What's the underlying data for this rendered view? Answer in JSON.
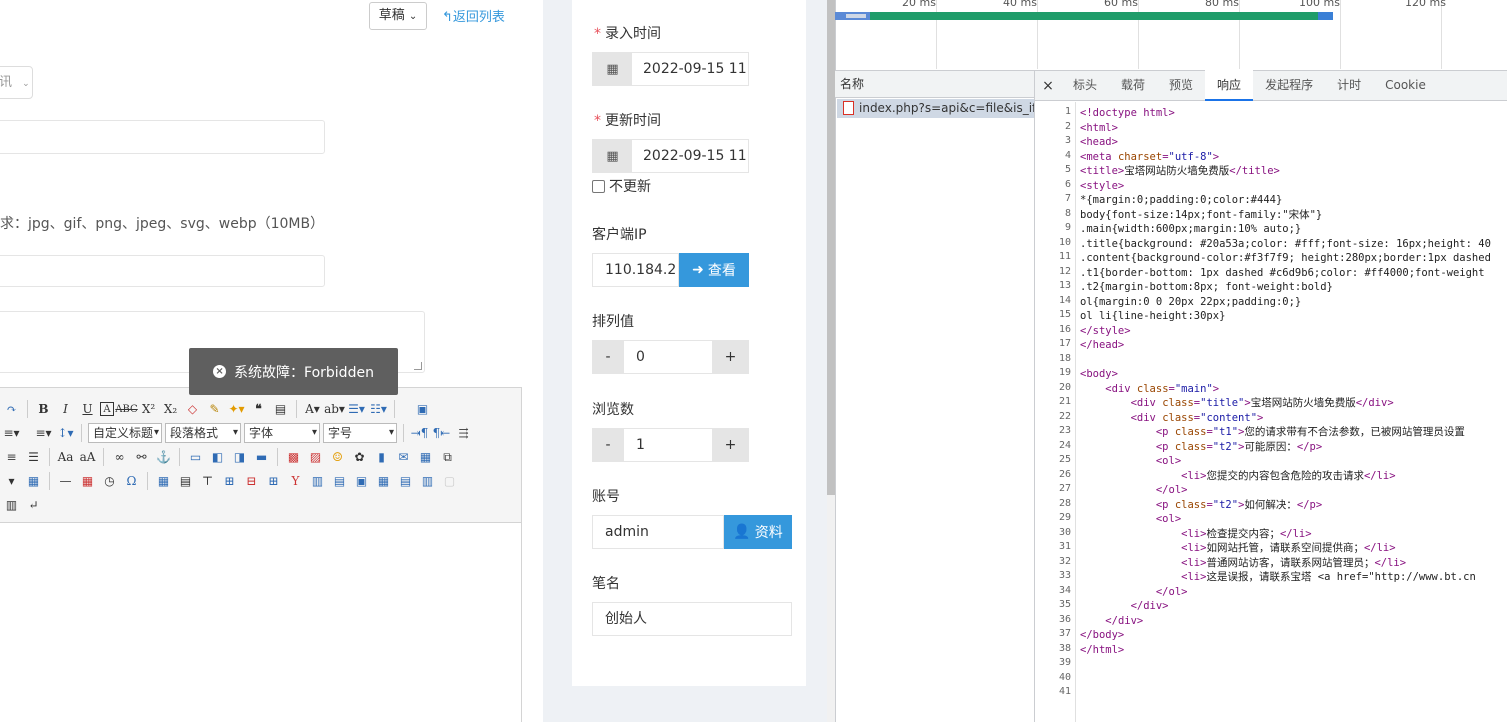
{
  "editor": {
    "draft_button": "草稿",
    "back_link": "返回列表",
    "fragment_select": "讯",
    "upload_hint": "求：jpg、gif、png、jpeg、svg、webp（10MB）",
    "toolbar": {
      "heading_dropdown": "自定义标题",
      "paragraph_dropdown": "段落格式",
      "font_dropdown": "字体",
      "size_dropdown": "字号"
    }
  },
  "toast": {
    "message": "系统故障：Forbidden"
  },
  "form": {
    "entry_time_label": "录入时间",
    "entry_time_value": "2022-09-15 11:",
    "update_time_label": "更新时间",
    "update_time_value": "2022-09-15 11:",
    "no_update_label": "不更新",
    "client_ip_label": "客户端IP",
    "client_ip_value": "110.184.2",
    "view_button": "查看",
    "sort_label": "排列值",
    "sort_value": "0",
    "views_label": "浏览数",
    "views_value": "1",
    "account_label": "账号",
    "account_value": "admin",
    "profile_button": "资料",
    "author_label": "笔名",
    "author_value": "创始人",
    "minus": "-",
    "plus": "+"
  },
  "devtools": {
    "timeline_labels": [
      "20 ms",
      "40 ms",
      "60 ms",
      "80 ms",
      "100 ms",
      "120 ms"
    ],
    "name_header": "名称",
    "request_name": "index.php?s=api&c=file&is_ifr...",
    "close_glyph": "×",
    "tabs": [
      "标头",
      "载荷",
      "预览",
      "响应",
      "发起程序",
      "计时",
      "Cookie"
    ],
    "active_tab": "响应",
    "line_numbers": [
      "1",
      "2",
      "3",
      "4",
      "5",
      "6",
      "7",
      "8",
      "9",
      "10",
      "11",
      "12",
      "13",
      "14",
      "15",
      "16",
      "17",
      "18",
      "19",
      "20",
      "21",
      "22",
      "23",
      "24",
      "25",
      "26",
      "27",
      "28",
      "29",
      "30",
      "31",
      "32",
      "33",
      "34",
      "35",
      "36",
      "37",
      "38",
      "39",
      "40",
      "41"
    ],
    "code_lines": [
      "<!doctype html>",
      "<html>",
      "<head>",
      "<meta charset=\"utf-8\">",
      "<title>宝塔网站防火墙免费版</title>",
      "<style>",
      "*{margin:0;padding:0;color:#444}",
      "body{font-size:14px;font-family:\"宋体\"}",
      ".main{width:600px;margin:10% auto;}",
      ".title{background: #20a53a;color: #fff;font-size: 16px;height: 40",
      ".content{background-color:#f3f7f9; height:280px;border:1px dashed",
      ".t1{border-bottom: 1px dashed #c6d9b6;color: #ff4000;font-weight",
      ".t2{margin-bottom:8px; font-weight:bold}",
      "ol{margin:0 0 20px 22px;padding:0;}",
      "ol li{line-height:30px}",
      "</style>",
      "</head>",
      "",
      "<body>",
      "    <div class=\"main\">",
      "        <div class=\"title\">宝塔网站防火墙免费版</div>",
      "        <div class=\"content\">",
      "            <p class=\"t1\">您的请求带有不合法参数，已被网站管理员设置",
      "            <p class=\"t2\">可能原因：</p>",
      "            <ol>",
      "                <li>您提交的内容包含危险的攻击请求</li>",
      "            </ol>",
      "            <p class=\"t2\">如何解决：</p>",
      "            <ol>",
      "                <li>检查提交内容；</li>",
      "                <li>如网站托管，请联系空间提供商；</li>",
      "                <li>普通网站访客，请联系网站管理员；</li>",
      "                <li>这是误报，请联系宝塔 <a href=\"http://www.bt.cn",
      "            </ol>",
      "        </div>",
      "    </div>",
      "</body>",
      "</html>",
      "",
      "",
      ""
    ]
  },
  "colors": {
    "accent_blue": "#3598dc",
    "required_red": "#e7505a",
    "toast_bg": "#5f5f5f",
    "devtools_active_tab": "#1a73e8"
  }
}
